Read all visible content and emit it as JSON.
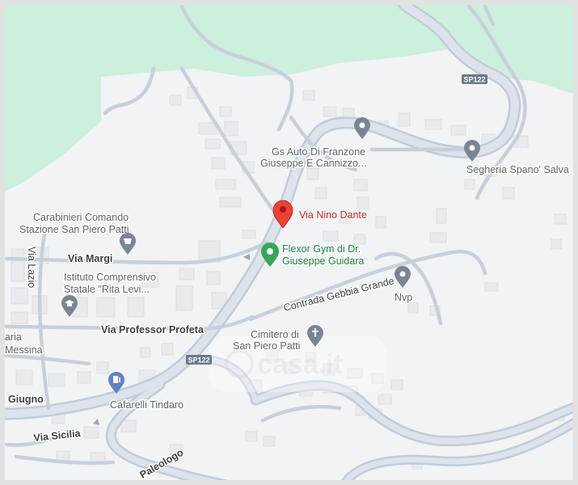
{
  "map": {
    "colors": {
      "land": "#f1f3f4",
      "park": "#cdefdd",
      "road_major": "#c1ccd8",
      "road_fill": "#dde3ea",
      "building": "#e8eaed",
      "pin_red": "#ea4335",
      "pin_green": "#34a853",
      "pin_gray": "#7a8594",
      "frame": "#e2e2e2"
    },
    "markers": {
      "selected": {
        "label": "Via Nino Dante",
        "icon": "red-location-pin-icon"
      },
      "gym": {
        "label_line1": "Flexor Gym di Dr.",
        "label_line2": "Giuseppe Guidara",
        "icon": "green-gym-pin-icon"
      },
      "auto": {
        "label_line1": "Gs Auto Di Franzone",
        "label_line2": "Giuseppe E Cannizzo...",
        "icon": "gray-poi-pin-icon"
      },
      "segheria": {
        "label": "Segheria Spano' Salva",
        "icon": "gray-poi-pin-icon"
      },
      "carabinieri": {
        "label_line1": "Carabinieri Comando",
        "label_line2": "Stazione San Piero Patti",
        "icon": "police-pin-icon"
      },
      "school": {
        "label_line1": "Istituto Comprensivo",
        "label_line2": "Statale \"Rita Levi...",
        "icon": "school-pin-icon"
      },
      "nvp": {
        "label": "Nvp",
        "icon": "gray-poi-pin-icon"
      },
      "cimitero": {
        "label_line1": "Cimitero di",
        "label_line2": "San Piero Patti",
        "icon": "cemetery-pin-icon"
      },
      "cafarelli": {
        "label": "Cafarelli Tindaro",
        "icon": "fuel-pin-icon"
      }
    },
    "streets": {
      "via_margi": "Via Margi",
      "via_lazio": "Via Lazio",
      "via_professor_profeta": "Via Professor Profeta",
      "contrada_gebbia_grande": "Contrada Gebbia Grande",
      "via_sicilia": "Via Sicilia",
      "paleologo": "Paleologo",
      "giugno": "Giugno",
      "aria_messina_1": "aria",
      "aria_messina_2": "Messina"
    },
    "route_shields": {
      "sp122_top": "SP122",
      "sp122_bottom": "SP122"
    },
    "watermark": "casa.it"
  }
}
